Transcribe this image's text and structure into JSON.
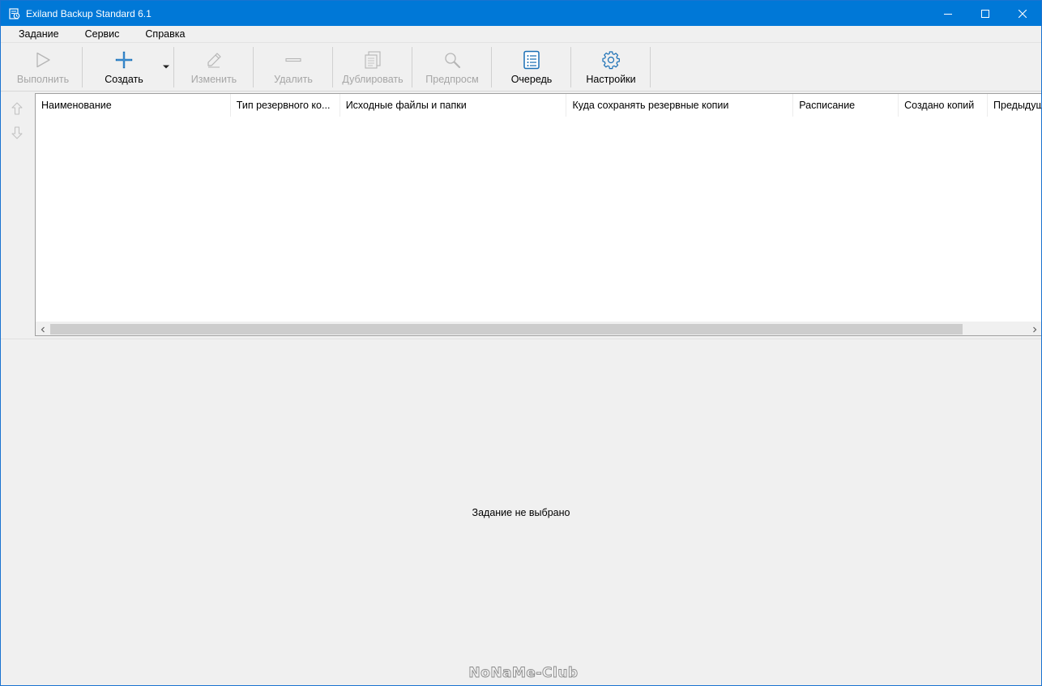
{
  "window": {
    "title": "Exiland Backup Standard 6.1"
  },
  "menu": {
    "items": [
      "Задание",
      "Сервис",
      "Справка"
    ]
  },
  "toolbar": {
    "run": {
      "label": "Выполнить",
      "icon": "play-icon",
      "enabled": false
    },
    "create": {
      "label": "Создать",
      "icon": "plus-icon",
      "enabled": true
    },
    "edit": {
      "label": "Изменить",
      "icon": "pencil-icon",
      "enabled": false
    },
    "delete": {
      "label": "Удалить",
      "icon": "minus-icon",
      "enabled": false
    },
    "duplicate": {
      "label": "Дублировать",
      "icon": "copy-icon",
      "enabled": false
    },
    "preview": {
      "label": "Предпросм",
      "icon": "magnifier-icon",
      "enabled": false
    },
    "queue": {
      "label": "Очередь",
      "icon": "list-icon",
      "enabled": true
    },
    "settings": {
      "label": "Настройки",
      "icon": "gear-icon",
      "enabled": true
    }
  },
  "grid": {
    "columns": [
      "Наименование",
      "Тип резервного ко...",
      "Исходные файлы и папки",
      "Куда сохранять резервные копии",
      "Расписание",
      "Создано копий",
      "Предыдущ"
    ],
    "rows": []
  },
  "details": {
    "empty_message": "Задание не выбрано"
  },
  "watermark": {
    "text": "NoNaMe-Club"
  },
  "colors": {
    "titlebar": "#0078d7",
    "accent_icon": "#1a6fb5",
    "disabled_text": "#a6a6a6"
  }
}
